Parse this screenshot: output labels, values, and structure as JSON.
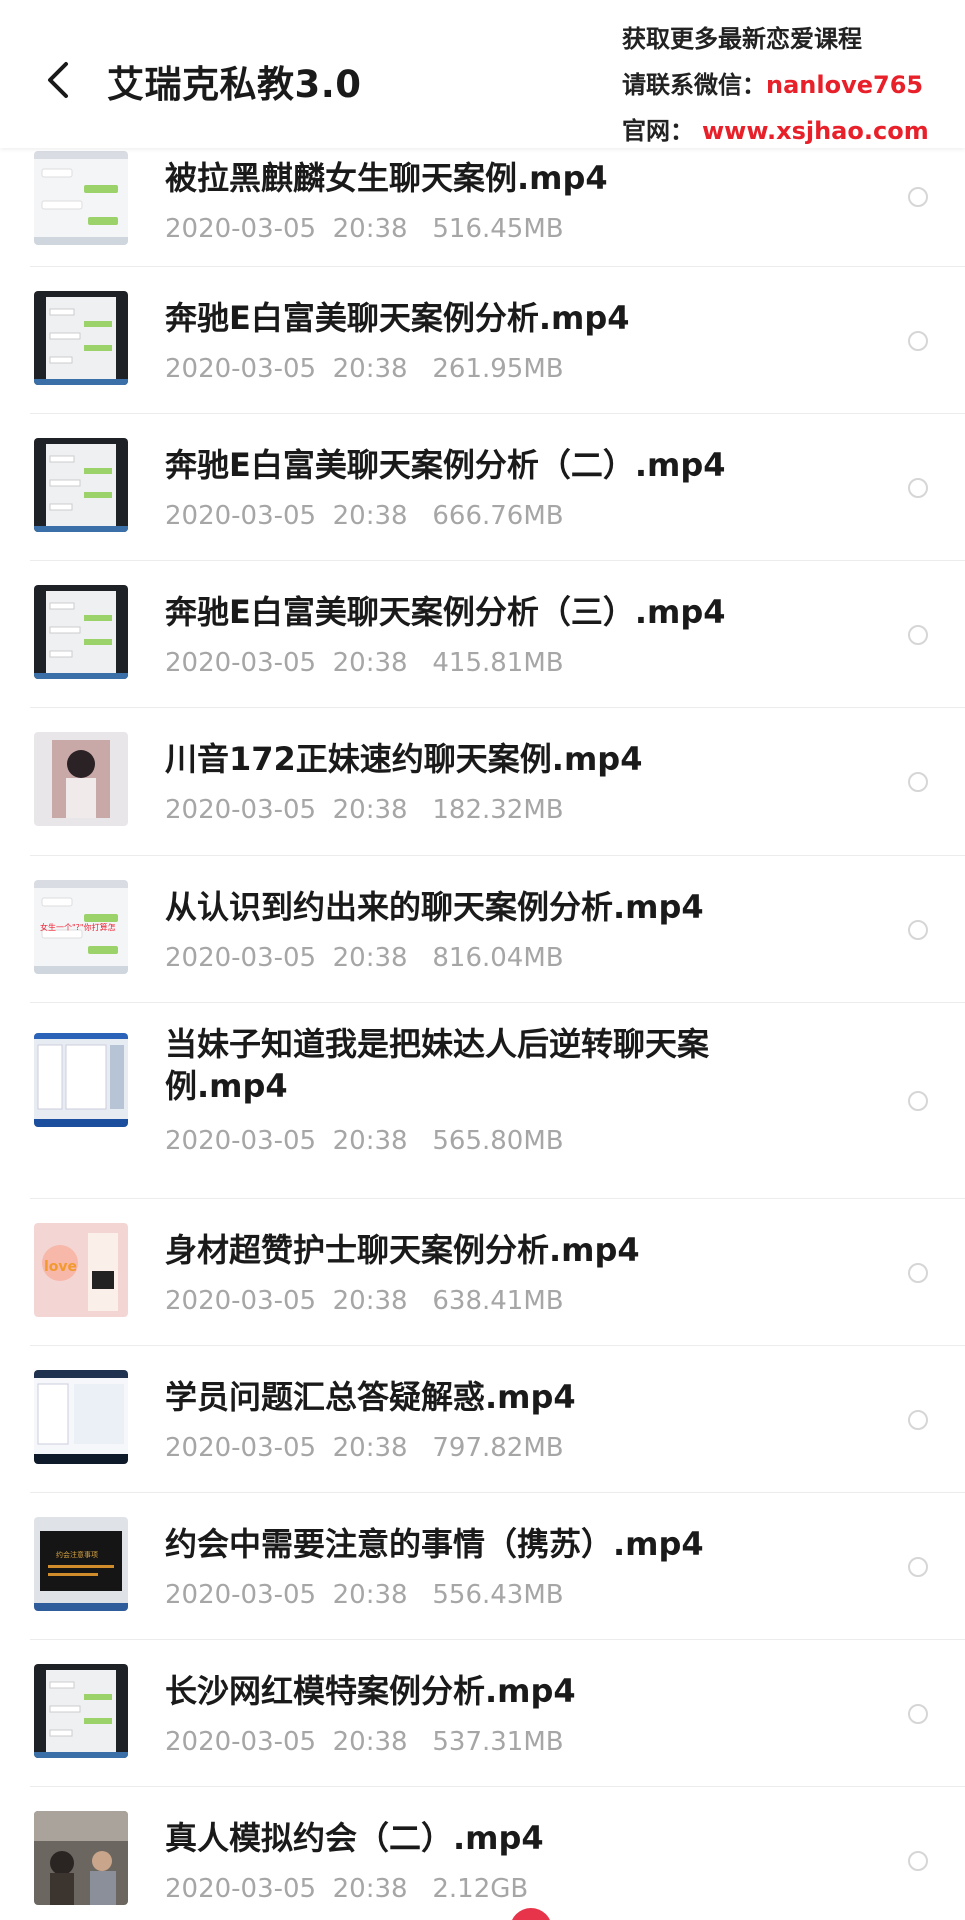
{
  "header": {
    "title": "艾瑞克私教3.0",
    "back_icon": "chevron-left-icon"
  },
  "promo": {
    "line1": "获取更多最新恋爱课程",
    "line2_label": "请联系微信：",
    "line2_value": "nanlove765",
    "line3_label": "官网：",
    "line3_value": "www.xsjhao.com",
    "accent_color": "#e8202a"
  },
  "files": [
    {
      "name": "被拉黑麒麟女生聊天案例.mp4",
      "date": "2020-03-05",
      "time": "20:38",
      "size": "516.45MB",
      "thumb": "chat-white"
    },
    {
      "name": "奔驰E白富美聊天案例分析.mp4",
      "date": "2020-03-05",
      "time": "20:38",
      "size": "261.95MB",
      "thumb": "chat-dark"
    },
    {
      "name": "奔驰E白富美聊天案例分析（二）.mp4",
      "date": "2020-03-05",
      "time": "20:38",
      "size": "666.76MB",
      "thumb": "chat-dark"
    },
    {
      "name": "奔驰E白富美聊天案例分析（三）.mp4",
      "date": "2020-03-05",
      "time": "20:38",
      "size": "415.81MB",
      "thumb": "chat-dark"
    },
    {
      "name": "川音172正妹速约聊天案例.mp4",
      "date": "2020-03-05",
      "time": "20:38",
      "size": "182.32MB",
      "thumb": "photo-girl"
    },
    {
      "name": "从认识到约出来的聊天案例分析.mp4",
      "date": "2020-03-05",
      "time": "20:38",
      "size": "816.04MB",
      "thumb": "chat-light"
    },
    {
      "name": "当妹子知道我是把妹达人后逆转聊天案例.mp4",
      "date": "2020-03-05",
      "time": "20:38",
      "size": "565.80MB",
      "thumb": "desktop-blue"
    },
    {
      "name": "身材超赞护士聊天案例分析.mp4",
      "date": "2020-03-05",
      "time": "20:38",
      "size": "638.41MB",
      "thumb": "photo-pink"
    },
    {
      "name": "学员问题汇总答疑解惑.mp4",
      "date": "2020-03-05",
      "time": "20:38",
      "size": "797.82MB",
      "thumb": "desktop-dark"
    },
    {
      "name": "约会中需要注意的事情（携苏）.mp4",
      "date": "2020-03-05",
      "time": "20:38",
      "size": "556.43MB",
      "thumb": "slides-dark"
    },
    {
      "name": "长沙网红模特案例分析.mp4",
      "date": "2020-03-05",
      "time": "20:38",
      "size": "537.31MB",
      "thumb": "chat-dark"
    },
    {
      "name": "真人模拟约会（二）.mp4",
      "date": "2020-03-05",
      "time": "20:38",
      "size": "2.12GB",
      "thumb": "photo-room"
    }
  ],
  "colors": {
    "title_text": "#1a1a1a",
    "meta_text": "#a6a6a6",
    "divider": "#ececec",
    "radio_border": "#d6d6d6",
    "fab": "#e8344a"
  }
}
